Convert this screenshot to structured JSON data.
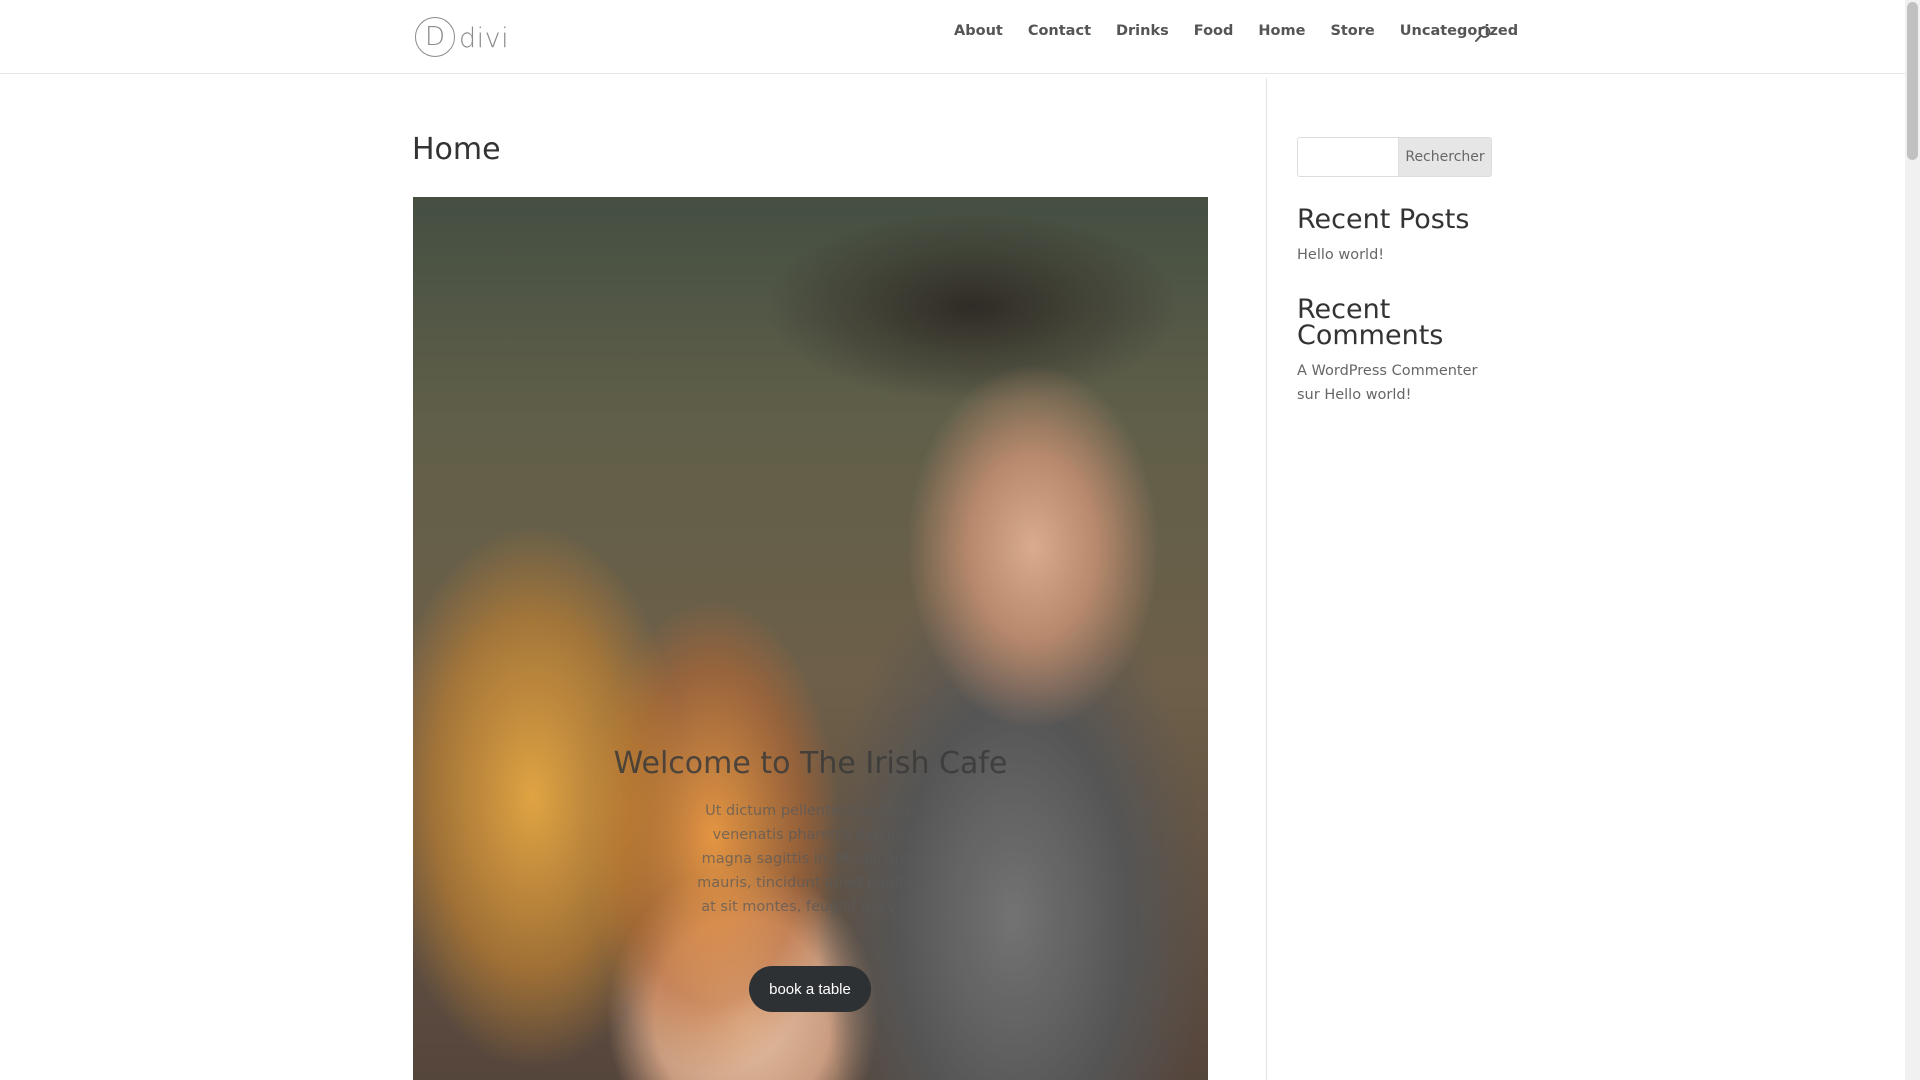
{
  "header": {
    "logo_text": "divi",
    "logo_letter": "D",
    "nav": [
      "About",
      "Contact",
      "Drinks",
      "Food",
      "Home",
      "Store",
      "Uncategorized"
    ]
  },
  "main": {
    "title": "Home",
    "hero": {
      "title": "Welcome to The Irish Cafe",
      "text": "Ut dictum pellentesque libero venenatis pharetra dapibus magna sagittis in. Morbi, ante, mauris, tincidunt amet habitant at sit montes, feugiat leo velit.",
      "button": "book a table"
    }
  },
  "sidebar": {
    "search": {
      "placeholder": "",
      "button": "Rechercher"
    },
    "recent_posts": {
      "title": "Recent Posts",
      "items": [
        "Hello world!"
      ]
    },
    "recent_comments": {
      "title": "Recent Comments",
      "author": "A WordPress Commenter",
      "connector": "sur",
      "post": "Hello world!"
    }
  },
  "icons": {
    "search": "search-icon"
  },
  "colors": {
    "button_bg": "#2d3134",
    "text": "#666666",
    "heading": "#333333"
  }
}
